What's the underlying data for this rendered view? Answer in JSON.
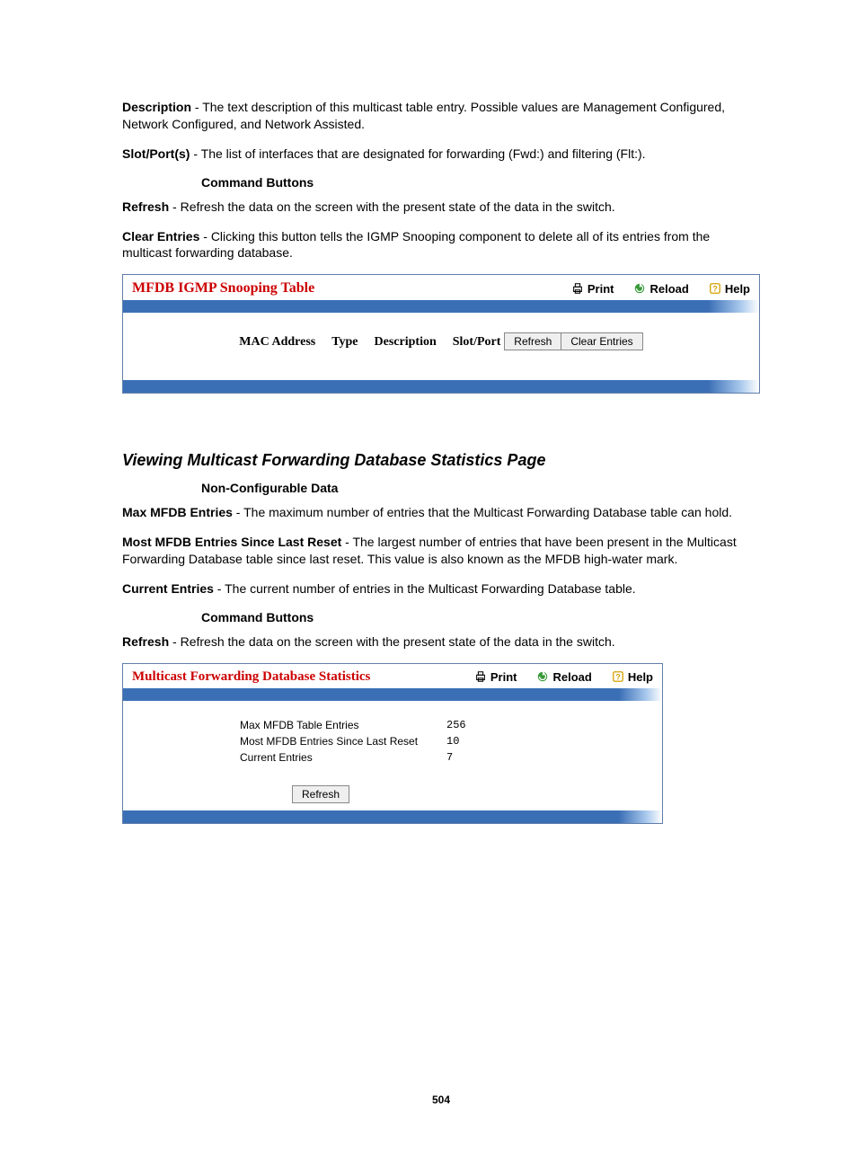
{
  "defs": {
    "description": {
      "label": "Description",
      "text": " - The text description of this multicast table entry. Possible values are Management Configured, Network Configured, and Network Assisted."
    },
    "slotport": {
      "label": "Slot/Port(s)",
      "text": " - The list of interfaces that are designated for forwarding (Fwd:) and filtering (Flt:)."
    },
    "cmd_heading1": "Command Buttons",
    "refresh1": {
      "label": "Refresh",
      "text": " - Refresh the data on the screen with the present state of the data in the switch."
    },
    "clear": {
      "label": "Clear Entries",
      "text": " - Clicking this button tells the IGMP Snooping component to delete all of its entries from the multicast forwarding database."
    }
  },
  "panel1": {
    "title": "MFDB IGMP Snooping Table",
    "print": "Print",
    "reload": "Reload",
    "help": "Help",
    "cols": {
      "mac": "MAC Address",
      "type": "Type",
      "desc": "Description",
      "slot": "Slot/Port"
    },
    "refresh_btn": "Refresh",
    "clear_btn": "Clear Entries"
  },
  "section2": {
    "heading": "Viewing Multicast Forwarding Database Statistics Page",
    "noncfg": "Non-Configurable Data",
    "max": {
      "label": "Max MFDB Entries",
      "text": " - The maximum number of entries that the Multicast Forwarding Database table can hold."
    },
    "most": {
      "label": "Most MFDB Entries Since Last Reset",
      "text": " - The largest number of entries that have been present in the Multicast Forwarding Database table since last reset. This value is also known as the MFDB high-water mark."
    },
    "curr": {
      "label": "Current Entries",
      "text": " - The current number of entries in the Multicast Forwarding Database table."
    },
    "cmd_heading2": "Command Buttons",
    "refresh2": {
      "label": "Refresh",
      "text": " - Refresh the data on the screen with the present state of the data in the switch."
    }
  },
  "panel2": {
    "title": "Multicast Forwarding Database Statistics",
    "print": "Print",
    "reload": "Reload",
    "help": "Help",
    "rows": {
      "max": {
        "label": "Max MFDB Table Entries",
        "value": "256"
      },
      "most": {
        "label": "Most MFDB Entries Since Last Reset",
        "value": "10"
      },
      "curr": {
        "label": "Current Entries",
        "value": "7"
      }
    },
    "refresh_btn": "Refresh"
  },
  "page_number": "504"
}
